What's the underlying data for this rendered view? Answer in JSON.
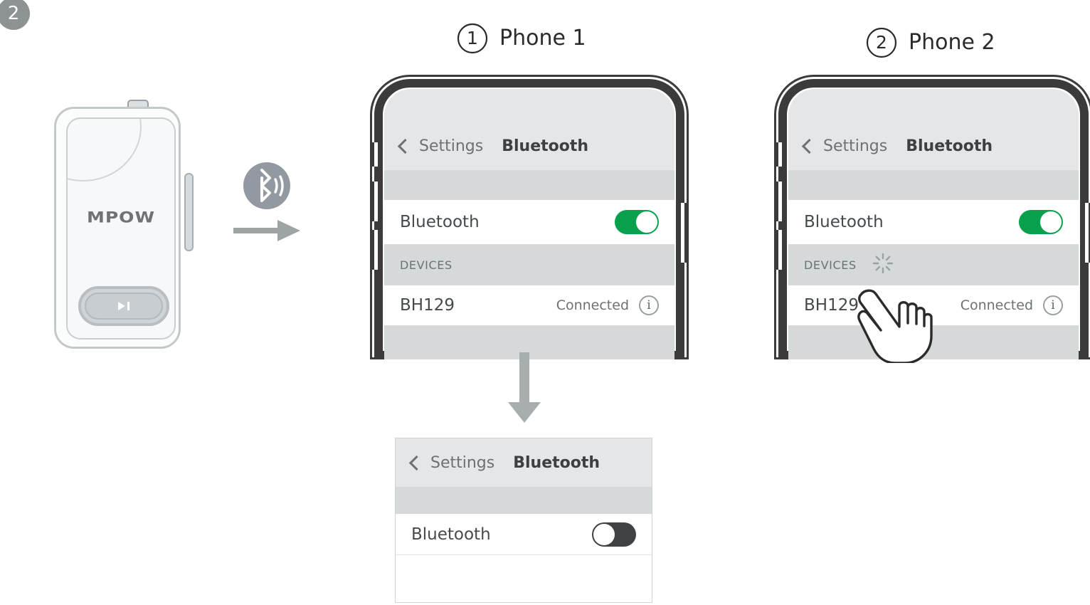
{
  "step_badge": {
    "number": "2"
  },
  "device": {
    "brand_logo": "MPOW",
    "play_pause_icon": "play-pause-icon",
    "bluetooth_icon": "bluetooth-broadcast-icon",
    "transfer_arrow_icon": "arrow-right-icon"
  },
  "phones": [
    {
      "marker": "1",
      "label": "Phone 1",
      "screen": {
        "navbar": {
          "back_label": "Settings",
          "title": "Bluetooth"
        },
        "bluetooth_row": {
          "label": "Bluetooth",
          "toggle_state": "on"
        },
        "section_header": {
          "label": "DEVICES",
          "spinner": false
        },
        "device_row": {
          "name": "BH129",
          "status": "Connected",
          "info_icon": "info-icon"
        }
      }
    },
    {
      "marker": "2",
      "label": "Phone 2",
      "screen": {
        "navbar": {
          "back_label": "Settings",
          "title": "Bluetooth"
        },
        "bluetooth_row": {
          "label": "Bluetooth",
          "toggle_state": "on"
        },
        "section_header": {
          "label": "DEVICES",
          "spinner": true
        },
        "device_row": {
          "name": "BH129",
          "status": "Connected",
          "info_icon": "info-icon"
        }
      },
      "tap_hand": "hand-tap-icon"
    }
  ],
  "flow": {
    "down_arrow_icon": "arrow-down-icon"
  },
  "bottom_panel": {
    "navbar": {
      "back_label": "Settings",
      "title": "Bluetooth"
    },
    "bluetooth_row": {
      "label": "Bluetooth",
      "toggle_state": "off"
    }
  },
  "colors": {
    "toggle_on": "#08a04d",
    "toggle_off": "#3e4244",
    "frame": "#3b3b3b",
    "screen_bg": "#e4e6e7",
    "row_bg": "#ffffff",
    "divider": "#d6d9da",
    "muted_text": "#6b7174",
    "badge_gray": "#8d9294"
  }
}
